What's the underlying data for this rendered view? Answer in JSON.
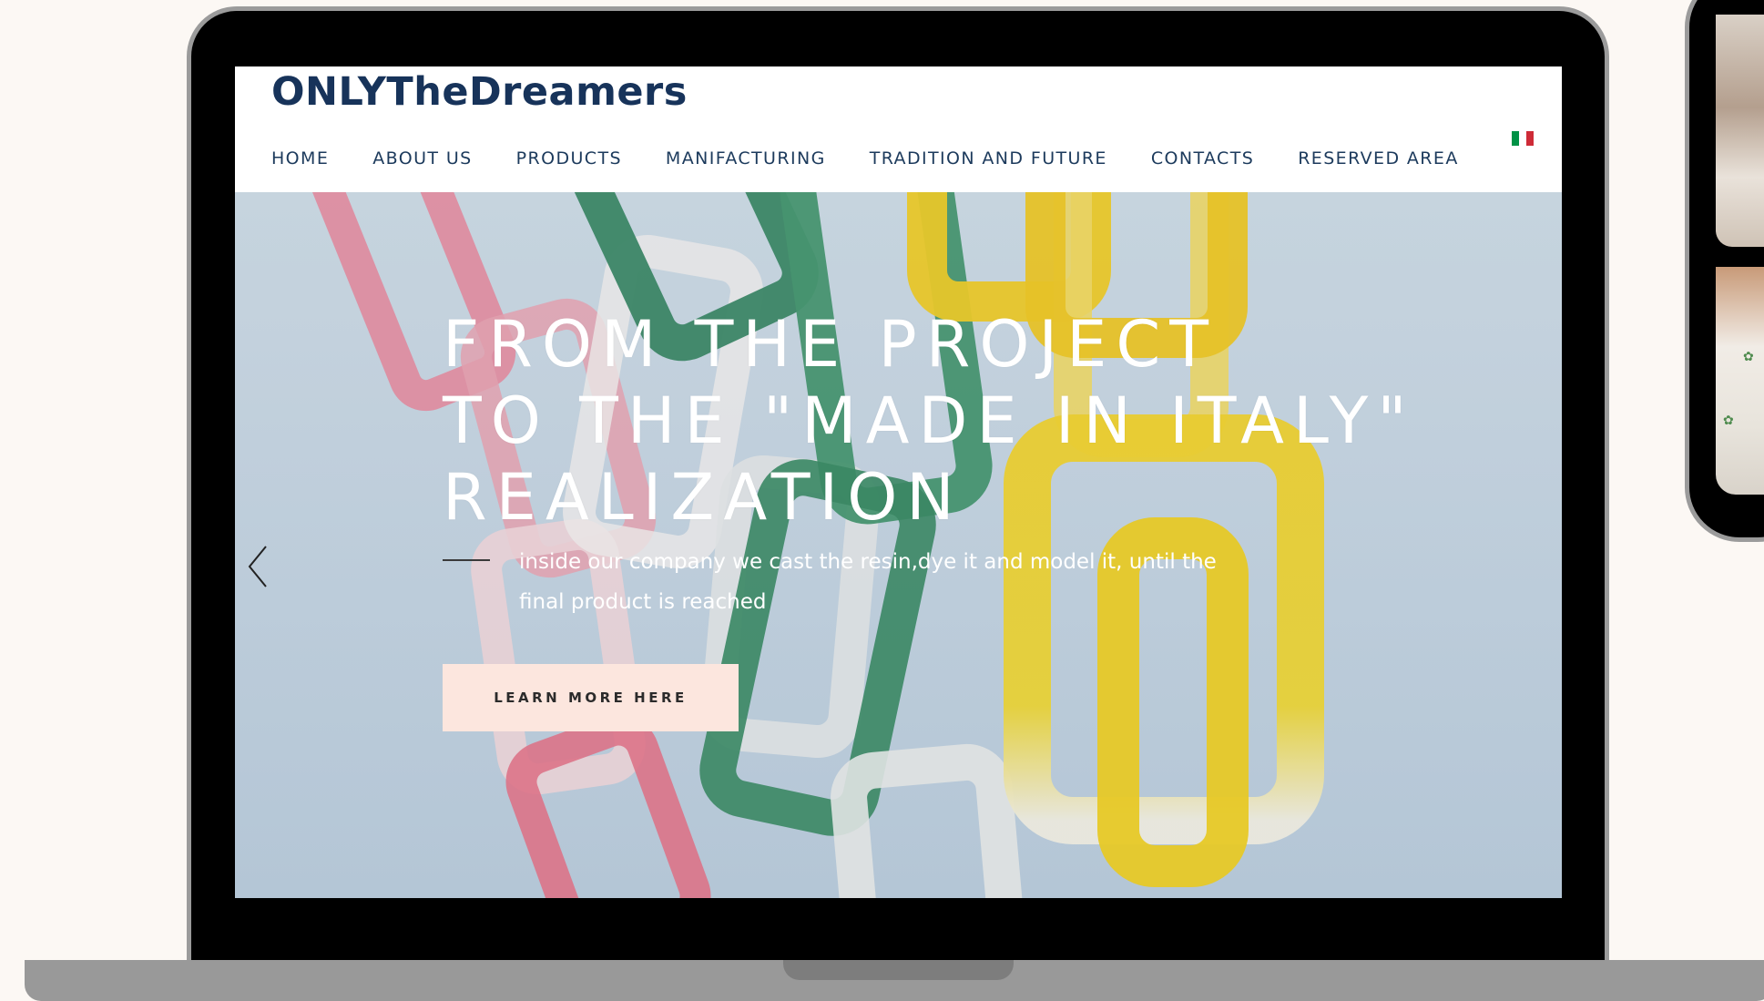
{
  "site": {
    "logo": "ONLYTheDreamers"
  },
  "nav": {
    "items": [
      {
        "label": "HOME"
      },
      {
        "label": "ABOUT US"
      },
      {
        "label": "PRODUCTS"
      },
      {
        "label": "MANIFACTURING"
      },
      {
        "label": "TRADITION AND FUTURE"
      },
      {
        "label": "CONTACTS"
      },
      {
        "label": "RESERVED AREA"
      }
    ],
    "language_flag": "italy-flag-icon"
  },
  "hero": {
    "title_lines": [
      "FROM THE PROJECT",
      "TO THE \"MADE IN ITALY\"",
      "REALIZATION"
    ],
    "subtitle": "inside our company we cast the resin,dye it and model it, until the final product is reached",
    "cta_label": "LEARN MORE HERE",
    "prev_icon": "chevron-left-icon"
  },
  "colors": {
    "page_background": "#fcf8f4",
    "brand_navy": "#17335a",
    "nav_text": "#1c3a5c",
    "cta_background": "#fce6de",
    "flag_green": "#009246",
    "flag_white": "#ffffff",
    "flag_red": "#ce2b37"
  }
}
